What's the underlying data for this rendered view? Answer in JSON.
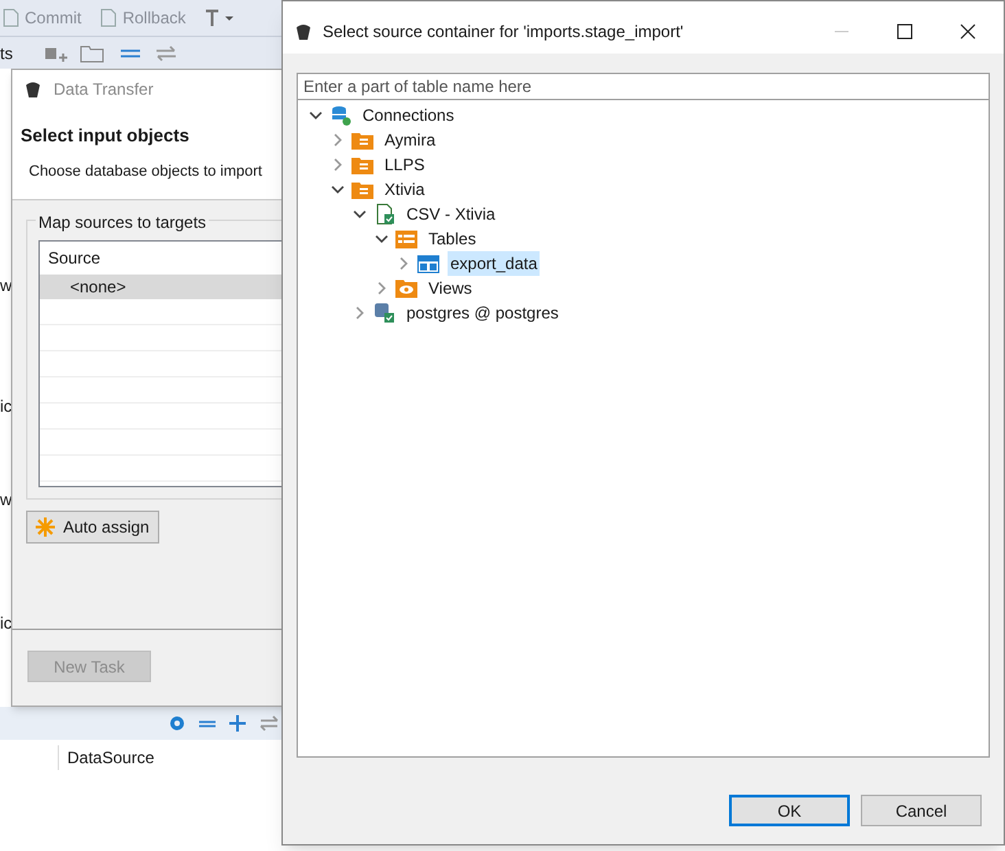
{
  "ide": {
    "toolbar": [
      {
        "label": "Commit",
        "disabled": true
      },
      {
        "label": "Rollback",
        "disabled": true
      }
    ],
    "tab_fragment": "ts",
    "side_fragments": [
      "w",
      "ic",
      "w",
      "ic"
    ],
    "bottom_cell": "DataSource"
  },
  "data_transfer": {
    "title": "Data Transfer",
    "active": false,
    "heading": "Select input objects",
    "subheading": "Choose database objects to import",
    "group": "Map sources to targets",
    "table": {
      "columns": [
        "Source"
      ],
      "rows": [
        {
          "source": "<none>",
          "selected": true
        }
      ]
    },
    "auto_assign": "Auto assign",
    "new_task": {
      "label": "New Task",
      "disabled": true
    }
  },
  "dialog": {
    "title": "Select source container for 'imports.stage_import'",
    "filter": {
      "placeholder": "Enter a part of table name here"
    },
    "tree": [
      {
        "label": "Connections",
        "kind": "connections",
        "expanded": true,
        "selected": false,
        "children": [
          {
            "label": "Aymira",
            "kind": "folder",
            "expanded": false,
            "selected": false
          },
          {
            "label": "LLPS",
            "kind": "folder",
            "expanded": false,
            "selected": false
          },
          {
            "label": "Xtivia",
            "kind": "folder",
            "expanded": true,
            "selected": false,
            "children": [
              {
                "label": "CSV - Xtivia",
                "kind": "csv",
                "expanded": true,
                "selected": false,
                "children": [
                  {
                    "label": "Tables",
                    "kind": "tables",
                    "expanded": true,
                    "selected": false,
                    "children": [
                      {
                        "label": "export_data",
                        "kind": "table",
                        "expanded": false,
                        "selected": true
                      }
                    ]
                  },
                  {
                    "label": "Views",
                    "kind": "views",
                    "expanded": false,
                    "selected": false
                  }
                ]
              },
              {
                "label": "postgres @ postgres",
                "kind": "postgres",
                "expanded": false,
                "selected": false
              }
            ]
          }
        ]
      }
    ],
    "buttons": [
      {
        "label": "OK",
        "default": true
      },
      {
        "label": "Cancel",
        "default": false
      }
    ]
  }
}
